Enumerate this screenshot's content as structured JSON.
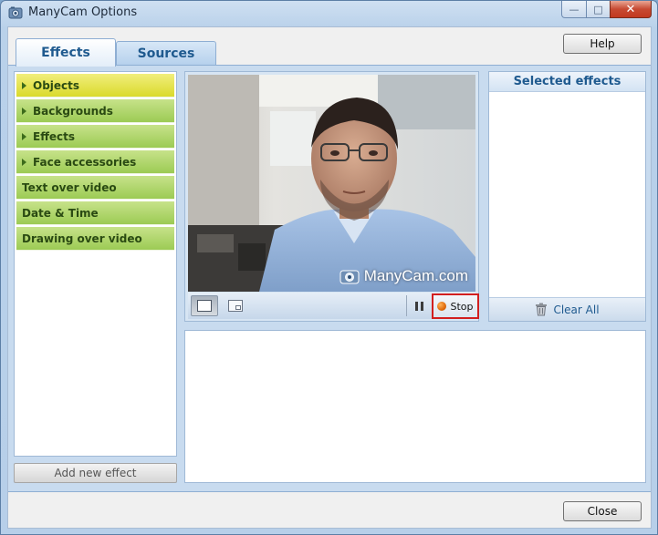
{
  "window": {
    "title": "ManyCam Options"
  },
  "tabs": [
    {
      "label": "Effects"
    },
    {
      "label": "Sources"
    }
  ],
  "toolbar": {
    "help_label": "Help"
  },
  "categories": [
    {
      "label": "Objects",
      "expandable": true,
      "active": true
    },
    {
      "label": "Backgrounds",
      "expandable": true
    },
    {
      "label": "Effects",
      "expandable": true
    },
    {
      "label": "Face accessories",
      "expandable": true
    },
    {
      "label": "Text over video",
      "expandable": false
    },
    {
      "label": "Date & Time",
      "expandable": false
    },
    {
      "label": "Drawing over video",
      "expandable": false
    }
  ],
  "left": {
    "add_effect_label": "Add new effect"
  },
  "preview": {
    "watermark": "ManyCam.com",
    "stop_label": "Stop"
  },
  "selected_effects": {
    "title": "Selected effects",
    "clear_all_label": "Clear All"
  },
  "footer": {
    "close_label": "Close"
  },
  "colors": {
    "accent_blue": "#1f5a8f",
    "category_green": "#9ccb54",
    "category_active": "#dada2c",
    "stop_highlight": "#d21f1f"
  }
}
